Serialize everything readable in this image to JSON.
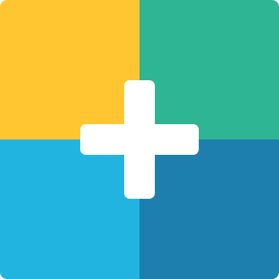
{
  "icon": {
    "name": "four-color-plus-app-icon",
    "quadrants": {
      "top_left": "#FFC631",
      "top_right": "#2DB594",
      "bottom_left": "#22B4E0",
      "bottom_right": "#1C7FAD"
    },
    "cross_color": "#FFFFFF",
    "background": "#FFFFFF"
  }
}
